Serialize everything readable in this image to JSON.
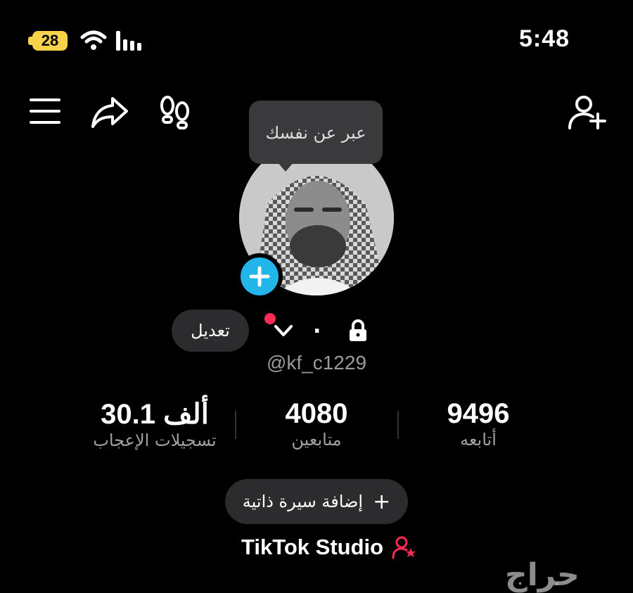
{
  "status_bar": {
    "battery_level": "28",
    "time": "5:48",
    "wifi_icon": "wifi-icon",
    "signal_icon": "cellular-signal-icon"
  },
  "top_bar": {
    "menu_icon": "menu-icon",
    "share_icon": "share-icon",
    "footprints_icon": "footprints-icon",
    "add_friend_icon": "add-user-icon"
  },
  "tooltip": {
    "text": "عبر عن نفسك"
  },
  "profile": {
    "edit_label": "تعديل",
    "name": ".",
    "handle": "@kf_c1229",
    "private": true
  },
  "stats": [
    {
      "value": "9496",
      "label": "أتابعه"
    },
    {
      "value": "4080",
      "label": "متابعين"
    },
    {
      "value": "30.1 ألف",
      "label": "تسجيلات الإعجاب"
    }
  ],
  "bio_button": {
    "plus": "+",
    "label": "إضافة سيرة ذاتية"
  },
  "studio": {
    "label": "TikTok Studio"
  },
  "watermark": {
    "text": "حراج"
  },
  "colors": {
    "accent_blue": "#22b5e9",
    "accent_red": "#fe2c55",
    "battery_yellow": "#f5d24a",
    "button_bg": "#2c2c2e",
    "tooltip_bg": "#3a3a3c"
  }
}
